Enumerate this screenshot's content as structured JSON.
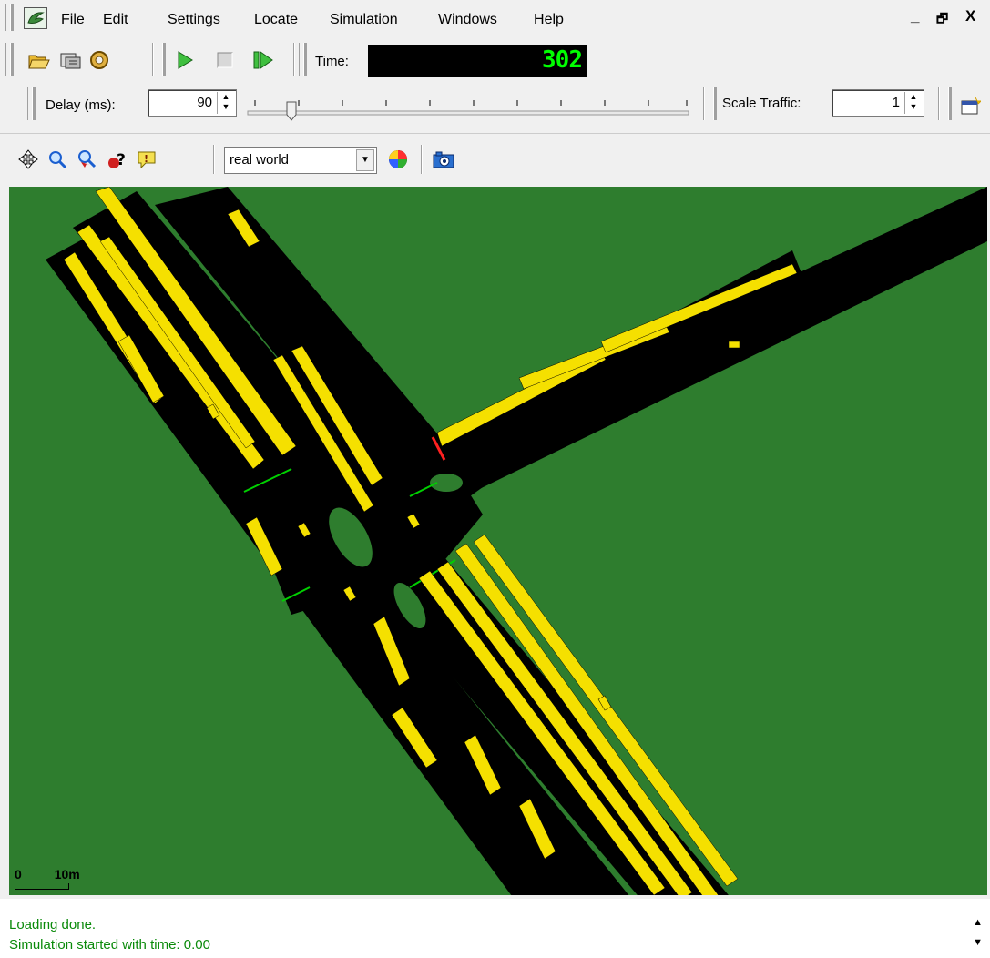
{
  "menu": {
    "items": [
      {
        "label": "File",
        "key": "F",
        "rest": "ile"
      },
      {
        "label": "Edit",
        "key": "E",
        "rest": "dit"
      },
      {
        "label": "Settings",
        "key": "S",
        "rest": "ettings"
      },
      {
        "label": "Locate",
        "key": "L",
        "rest": "ocate"
      },
      {
        "label": "Simulation",
        "key": "",
        "rest": "Simulation"
      },
      {
        "label": "Windows",
        "key": "W",
        "rest": "indows"
      },
      {
        "label": "Help",
        "key": "H",
        "rest": "elp"
      }
    ],
    "window_controls": [
      "_",
      "🗗",
      "X"
    ]
  },
  "toolbar": {
    "time_label": "Time:",
    "time_value": "302",
    "delay_label": "Delay (ms):",
    "delay_value": "90",
    "scale_traffic_label": "Scale Traffic:",
    "scale_traffic_value": "1",
    "scheme_value": "real world"
  },
  "viewport": {
    "scale_zero": "0",
    "scale_length": "10m",
    "background_color": "#2e7d2e"
  },
  "log": {
    "lines": [
      "Loading done.",
      "Simulation started with time: 0.00"
    ]
  }
}
